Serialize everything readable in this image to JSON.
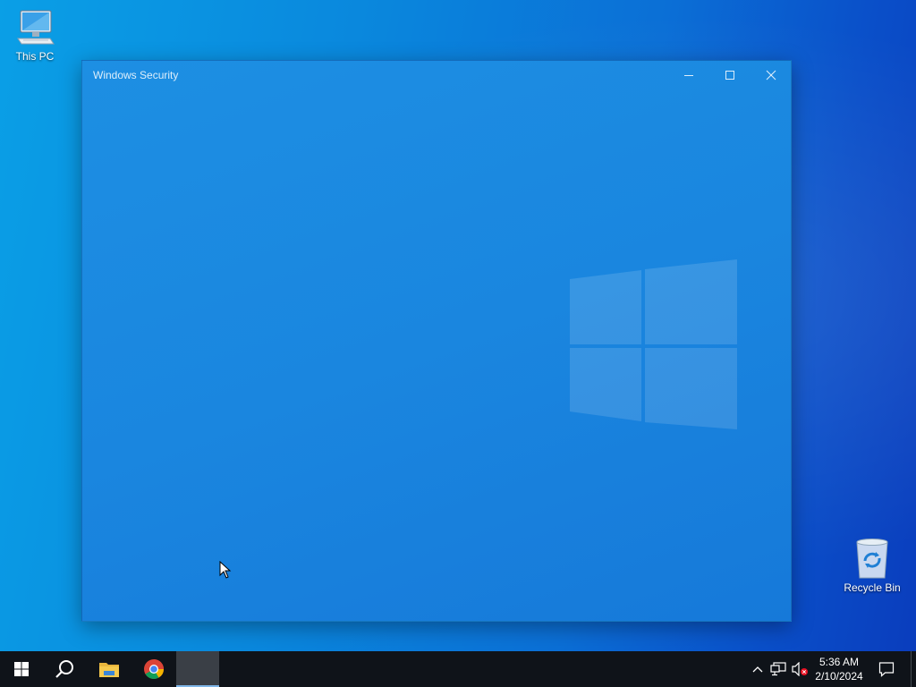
{
  "desktop": {
    "icons": [
      {
        "label": "This PC",
        "icon": "computer-icon"
      },
      {
        "label": "Recycle Bin",
        "icon": "recycle-bin-icon"
      }
    ]
  },
  "window": {
    "title": "Windows Security",
    "controls": {
      "minimize": "minimize-icon",
      "maximize": "maximize-icon",
      "close": "close-icon"
    }
  },
  "taskbar": {
    "items": [
      {
        "name": "Start",
        "icon": "windows-logo-icon"
      },
      {
        "name": "Search",
        "icon": "search-icon"
      },
      {
        "name": "File Explorer",
        "icon": "folder-icon"
      },
      {
        "name": "Google Chrome",
        "icon": "chrome-icon"
      },
      {
        "name": "Windows Security",
        "icon": "app-icon"
      }
    ],
    "tray": {
      "icons": [
        "chevron-up-icon",
        "network-icon",
        "volume-muted-icon",
        "notification-icon"
      ],
      "time": "5:36 AM",
      "date": "2/10/2024"
    }
  },
  "colors": {
    "window_accent": "#1a86df",
    "taskbar": "#0f1319",
    "active_task_indicator": "#7fb6e8"
  }
}
